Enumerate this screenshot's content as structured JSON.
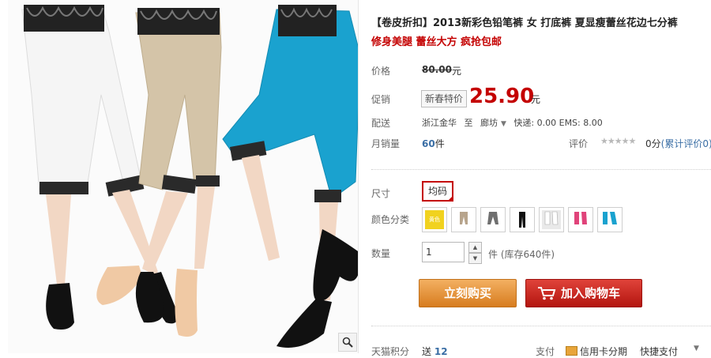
{
  "title": "【卷皮折扣】2013新彩色铅笔裤 女 打底裤 夏显瘦蕾丝花边七分裤",
  "subtitle": "修身美腿 蕾丝大方 疯抢包邮",
  "price": {
    "label": "价格",
    "original": "80.00",
    "currency": "元"
  },
  "promo": {
    "label": "促销",
    "badge": "新春特价",
    "price": "25.90",
    "currency": "元"
  },
  "shipping": {
    "label": "配送",
    "from": "浙江金华",
    "to_word": "至",
    "to": "廊坊",
    "detail": "快递: 0.00 EMS: 8.00"
  },
  "sales": {
    "label": "月销量",
    "count": "60",
    "unit": "件",
    "rating_label": "评价",
    "stars": "★★★★★",
    "rating_score": "0分",
    "review_link": "(累计评价0)"
  },
  "size": {
    "label": "尺寸",
    "selected": "均码"
  },
  "color": {
    "label": "颜色分类",
    "swatches": [
      {
        "name": "yellow",
        "color": "#f1d21f",
        "text": "黄色"
      },
      {
        "name": "khaki",
        "color": "#b7a48c"
      },
      {
        "name": "gray",
        "color": "#6f6f6f"
      },
      {
        "name": "black",
        "color": "#111111"
      },
      {
        "name": "white",
        "color": "#f4f4f4"
      },
      {
        "name": "rose",
        "color": "#e0437a"
      },
      {
        "name": "blue",
        "color": "#1aa2cf"
      }
    ]
  },
  "quantity": {
    "label": "数量",
    "value": "1",
    "unit": "件",
    "stock": "(库存640件)"
  },
  "buttons": {
    "buy_now": "立刻购买",
    "add_cart": "加入购物车"
  },
  "footer": {
    "points_label": "天猫积分",
    "points_prefix": "送",
    "points_value": "12",
    "pay_label": "支付",
    "pay_card": "信用卡分期",
    "pay_fast": "快捷支付"
  },
  "colors": {
    "accent_red": "#c40000",
    "buy_orange": "#e58f2f",
    "cart_red": "#c4201a",
    "link_blue": "#3a6ea5"
  },
  "icons": [
    "zoom-icon",
    "dropdown-icon",
    "cart-icon",
    "credit-card-icon",
    "star-icon"
  ]
}
